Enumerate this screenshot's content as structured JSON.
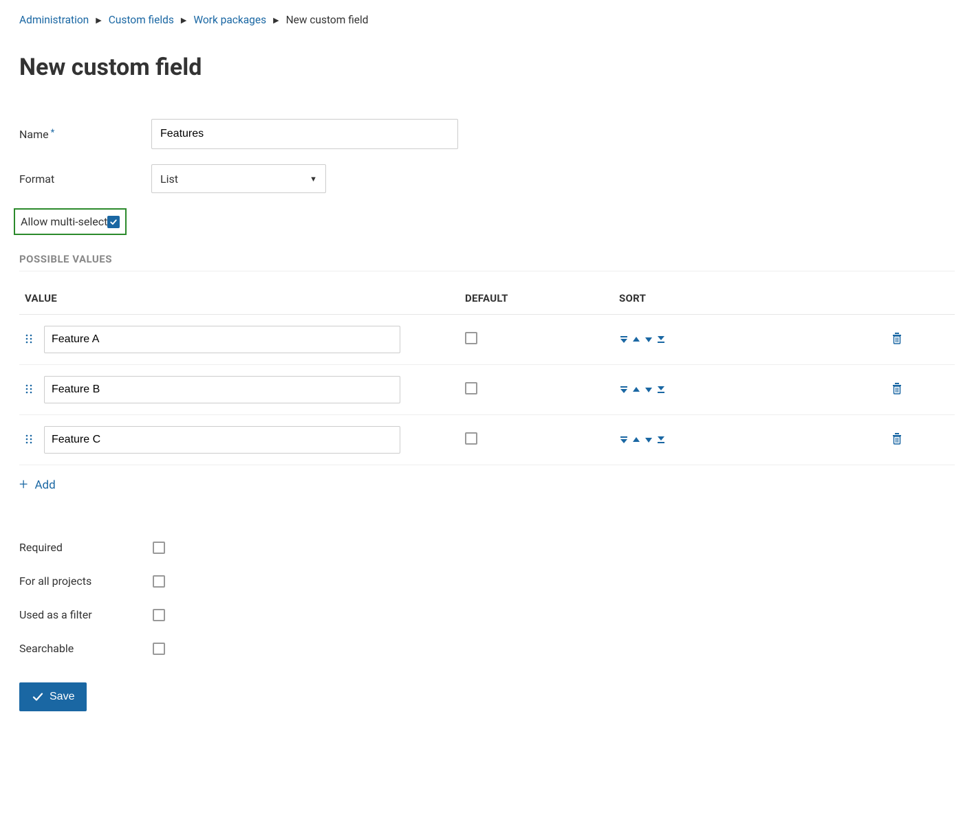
{
  "breadcrumb": {
    "items": [
      {
        "label": "Administration",
        "link": true
      },
      {
        "label": "Custom fields",
        "link": true
      },
      {
        "label": "Work packages",
        "link": true
      },
      {
        "label": "New custom field",
        "link": false
      }
    ]
  },
  "page_title": "New custom field",
  "form": {
    "name_label": "Name",
    "name_value": "Features",
    "format_label": "Format",
    "format_value": "List",
    "multi_select_label": "Allow multi-select",
    "multi_select_checked": true
  },
  "possible_values": {
    "section_title": "POSSIBLE VALUES",
    "headers": {
      "value": "VALUE",
      "default": "DEFAULT",
      "sort": "SORT"
    },
    "rows": [
      {
        "value": "Feature A",
        "default": false
      },
      {
        "value": "Feature B",
        "default": false
      },
      {
        "value": "Feature C",
        "default": false
      }
    ],
    "add_label": "Add"
  },
  "options": {
    "required_label": "Required",
    "required_checked": false,
    "for_all_label": "For all projects",
    "for_all_checked": false,
    "filter_label": "Used as a filter",
    "filter_checked": false,
    "searchable_label": "Searchable",
    "searchable_checked": false
  },
  "save_label": "Save"
}
